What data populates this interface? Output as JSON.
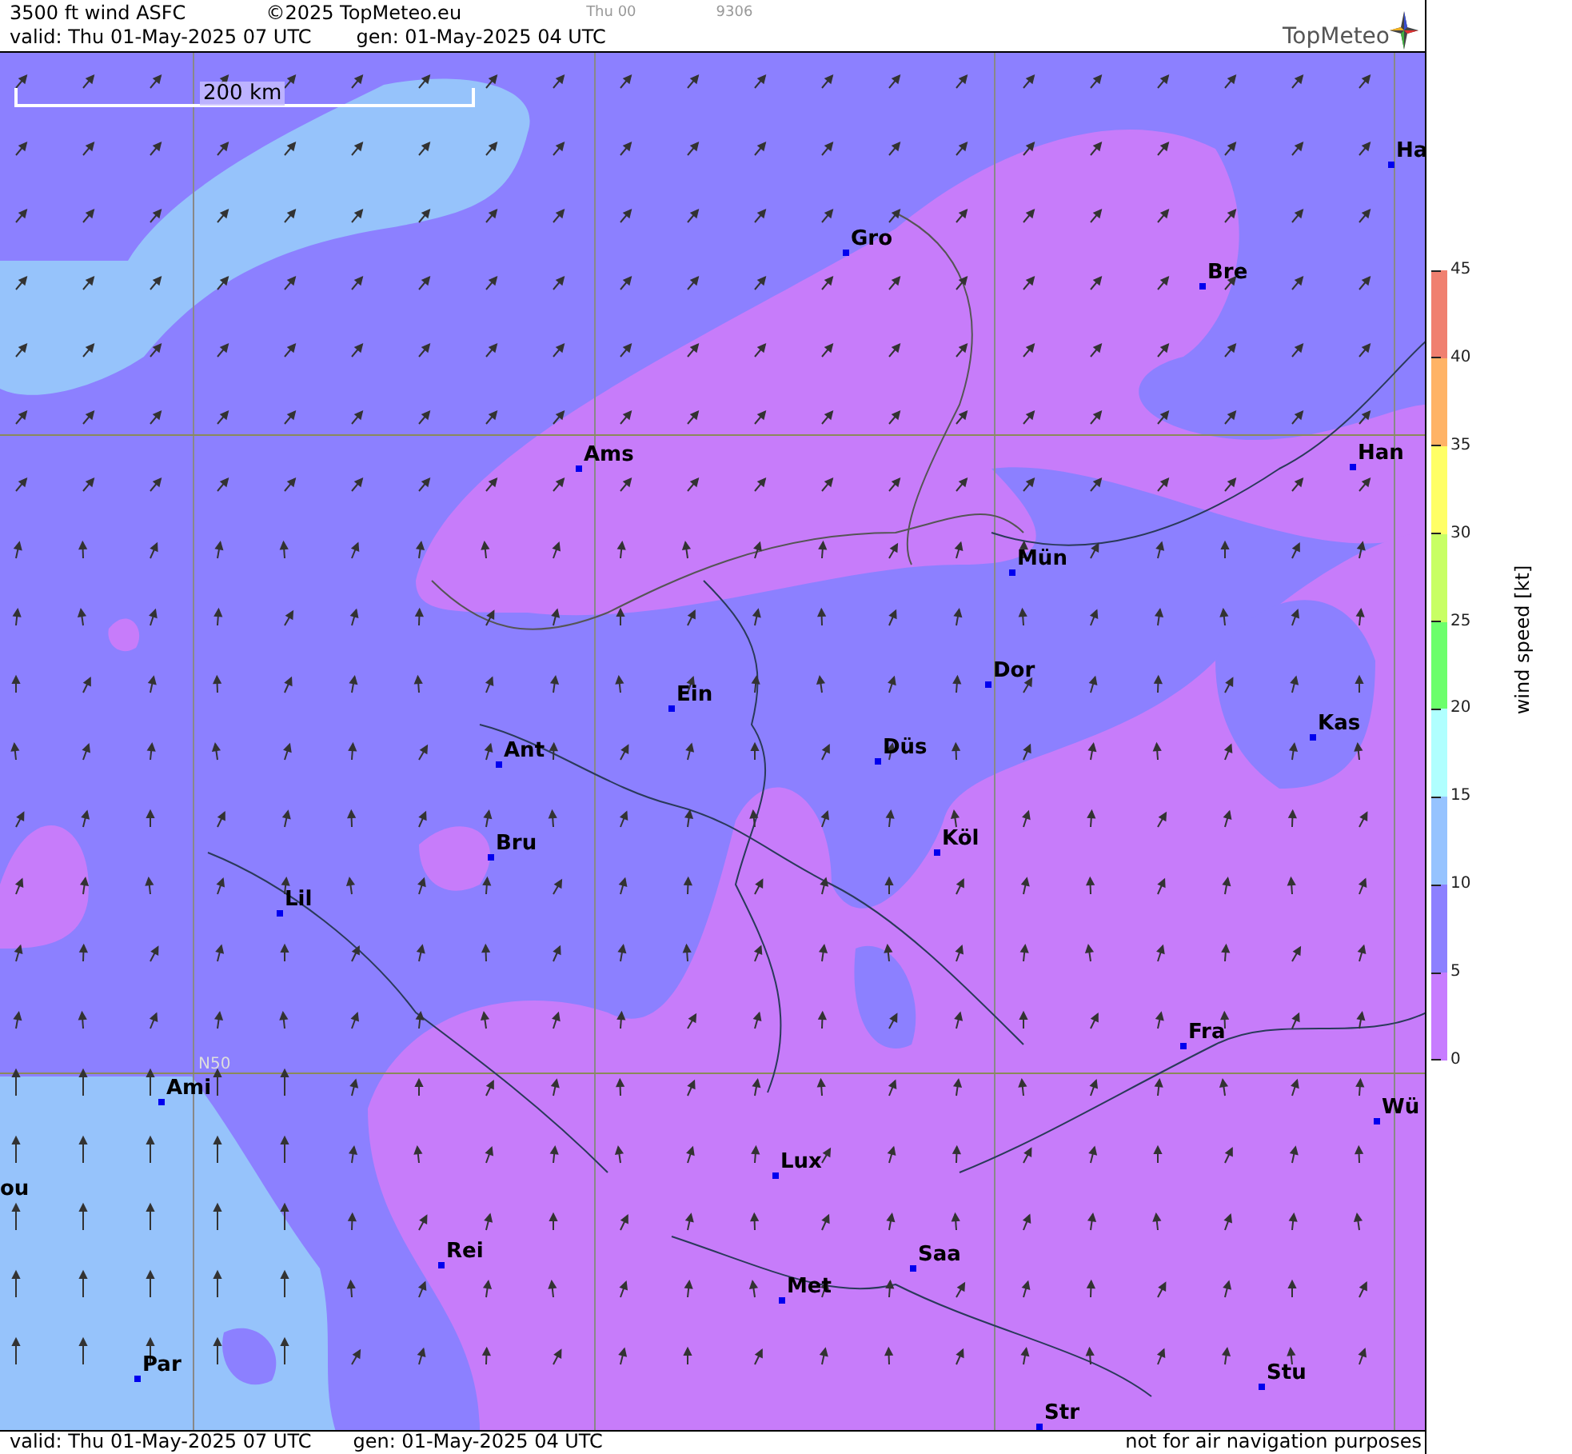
{
  "header": {
    "title": "3500 ft wind ASFC",
    "copyright": "©2025 TopMeteo.eu",
    "run_label": "Thu 00",
    "code": "9306",
    "valid": "valid:  Thu  01-May-2025  07 UTC",
    "generated": "gen: 01-May-2025 04 UTC",
    "logo": "TopMeteo"
  },
  "map": {
    "scale_label": "200 km",
    "latitude_label": "N50",
    "cities": [
      {
        "name": "Ha"
      },
      {
        "name": "Gro"
      },
      {
        "name": "Bre"
      },
      {
        "name": "Ams"
      },
      {
        "name": "Han"
      },
      {
        "name": "Mün"
      },
      {
        "name": "Dor"
      },
      {
        "name": "Ein"
      },
      {
        "name": "Kas"
      },
      {
        "name": "Ant"
      },
      {
        "name": "Düs"
      },
      {
        "name": "Köl"
      },
      {
        "name": "Bru"
      },
      {
        "name": "Lil"
      },
      {
        "name": "Fra"
      },
      {
        "name": "Ami"
      },
      {
        "name": "Wü"
      },
      {
        "name": "Lux"
      },
      {
        "name": "ou"
      },
      {
        "name": "Rei"
      },
      {
        "name": "Saa"
      },
      {
        "name": "Met"
      },
      {
        "name": "Stu"
      },
      {
        "name": "Par"
      },
      {
        "name": "Str"
      }
    ]
  },
  "legend": {
    "title": "wind speed [kt]",
    "ticks": [
      "45",
      "40",
      "35",
      "30",
      "25",
      "20",
      "15",
      "10",
      "5",
      "0"
    ],
    "bands": [
      {
        "color": "#f08070"
      },
      {
        "color": "#ffb366"
      },
      {
        "color": "#ffff66"
      },
      {
        "color": "#c8ff64"
      },
      {
        "color": "#6cff6c"
      },
      {
        "color": "#b0ffff"
      },
      {
        "color": "#96c3ff"
      },
      {
        "color": "#8c80ff"
      },
      {
        "color": "#c77cff"
      }
    ]
  },
  "footer": {
    "valid": "valid:  Thu  01-May-2025  07 UTC",
    "generated": "gen: 01-May-2025 04 UTC",
    "disclaimer": "not for air navigation purposes"
  }
}
